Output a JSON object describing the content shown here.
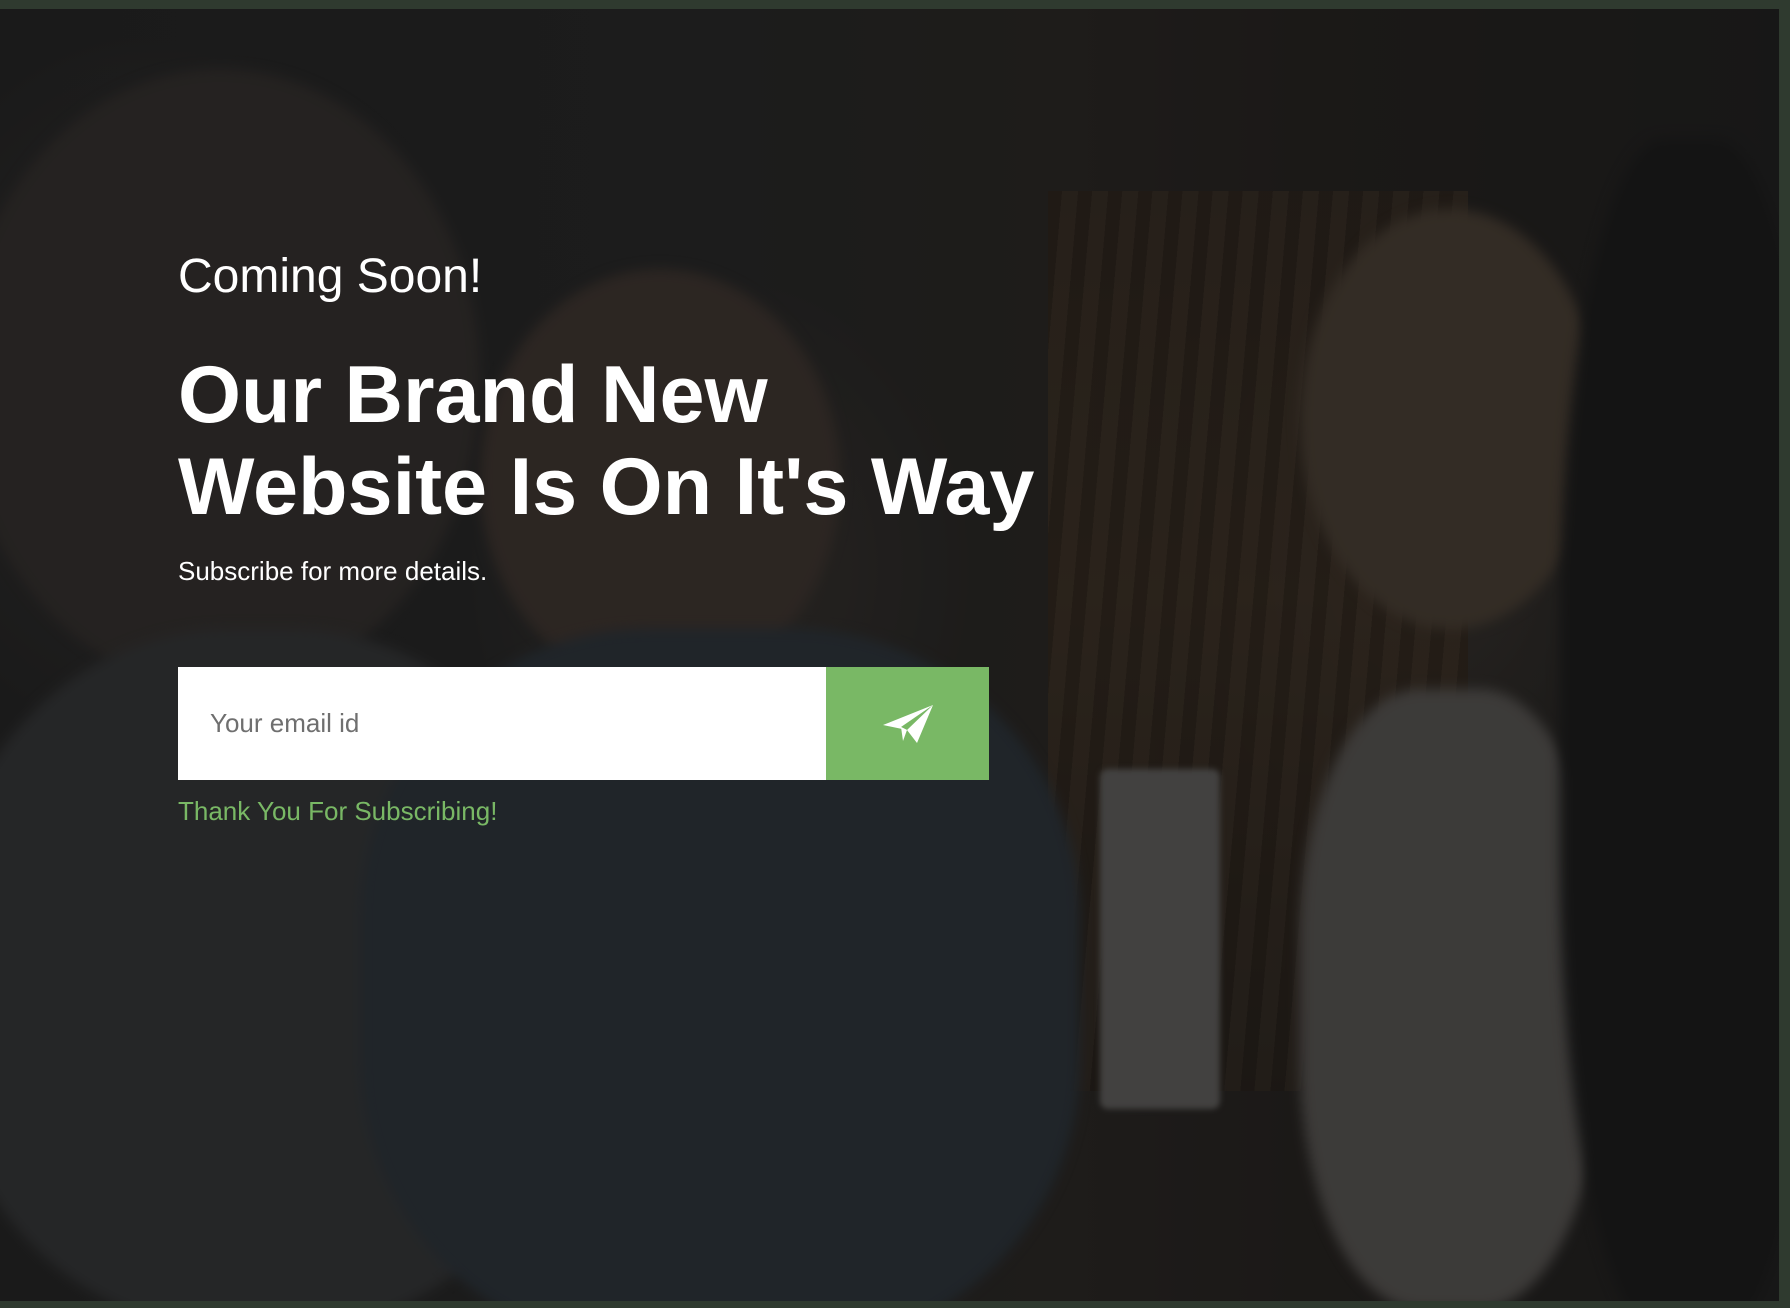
{
  "hero": {
    "eyebrow": "Coming Soon!",
    "headline_line1": "Our Brand New",
    "headline_line2": "Website Is On It's Way",
    "subtext": "Subscribe for more details."
  },
  "subscribe": {
    "email_placeholder": "Your email id",
    "email_value": "",
    "submit_icon": "paper-plane-icon",
    "success_message": "Thank You For Subscribing!"
  },
  "colors": {
    "accent": "#79b865",
    "text": "#ffffff",
    "input_background": "#ffffff",
    "frame": "#2f3a2f"
  }
}
